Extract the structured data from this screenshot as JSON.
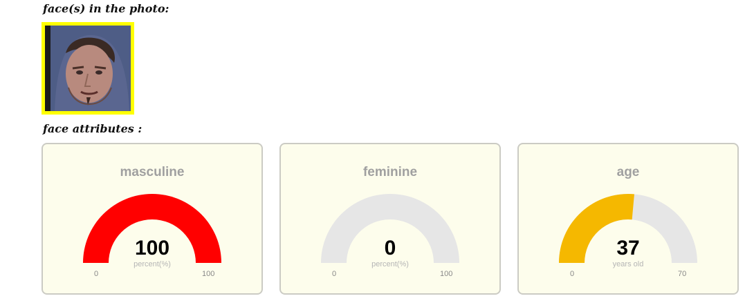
{
  "headings": {
    "faces": "face(s) in the photo:",
    "attributes": "face attributes :"
  },
  "face_thumbnail": {
    "highlight_color": "#ffff00"
  },
  "cards": [
    {
      "title": "masculine",
      "value": 100,
      "display": "100",
      "unit": "percent(%)",
      "min": 0,
      "max": 100,
      "min_label": "0",
      "max_label": "100",
      "color": "#ff0000"
    },
    {
      "title": "feminine",
      "value": 0,
      "display": "0",
      "unit": "percent(%)",
      "min": 0,
      "max": 100,
      "min_label": "0",
      "max_label": "100",
      "color": "#ff0000"
    },
    {
      "title": "age",
      "value": 37,
      "display": "37",
      "unit": "years old",
      "min": 0,
      "max": 70,
      "min_label": "0",
      "max_label": "70",
      "color": "#f5b800"
    }
  ],
  "gauge_track_color": "#e6e6e6"
}
